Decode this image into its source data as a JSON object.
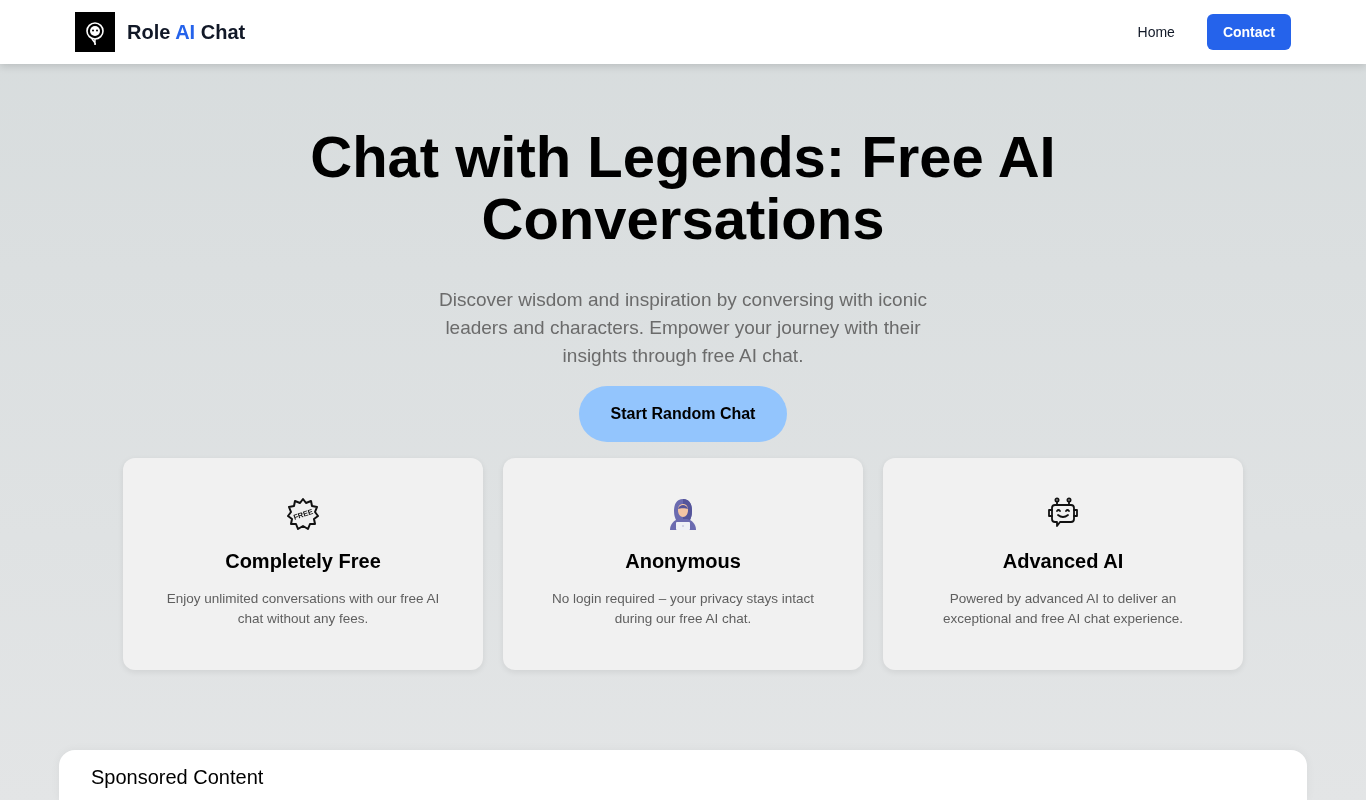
{
  "header": {
    "brand": [
      {
        "text": "Role",
        "accent": false
      },
      {
        "text": "AI",
        "accent": true
      },
      {
        "text": "Chat",
        "accent": false
      }
    ],
    "nav": [
      {
        "label": "Home",
        "kind": "link"
      },
      {
        "label": "Contact",
        "kind": "button"
      }
    ]
  },
  "hero": {
    "title": "Chat with Legends: Free AI Conversations",
    "subtitle": "Discover wisdom and inspiration by conversing with iconic leaders and characters. Empower your journey with their insights through free AI chat.",
    "button": "Start Random Chat"
  },
  "features": [
    {
      "title": "Completely Free",
      "description": "Enjoy unlimited conversations with our free AI chat without any fees.",
      "icon_text": "FREE"
    },
    {
      "title": "Anonymous",
      "description": "No login required – your privacy stays intact during our free AI chat."
    },
    {
      "title": "Advanced AI",
      "description": "Powered by advanced AI to deliver an exceptional and free AI chat experience."
    }
  ],
  "sponsored": {
    "title": "Sponsored Content"
  }
}
